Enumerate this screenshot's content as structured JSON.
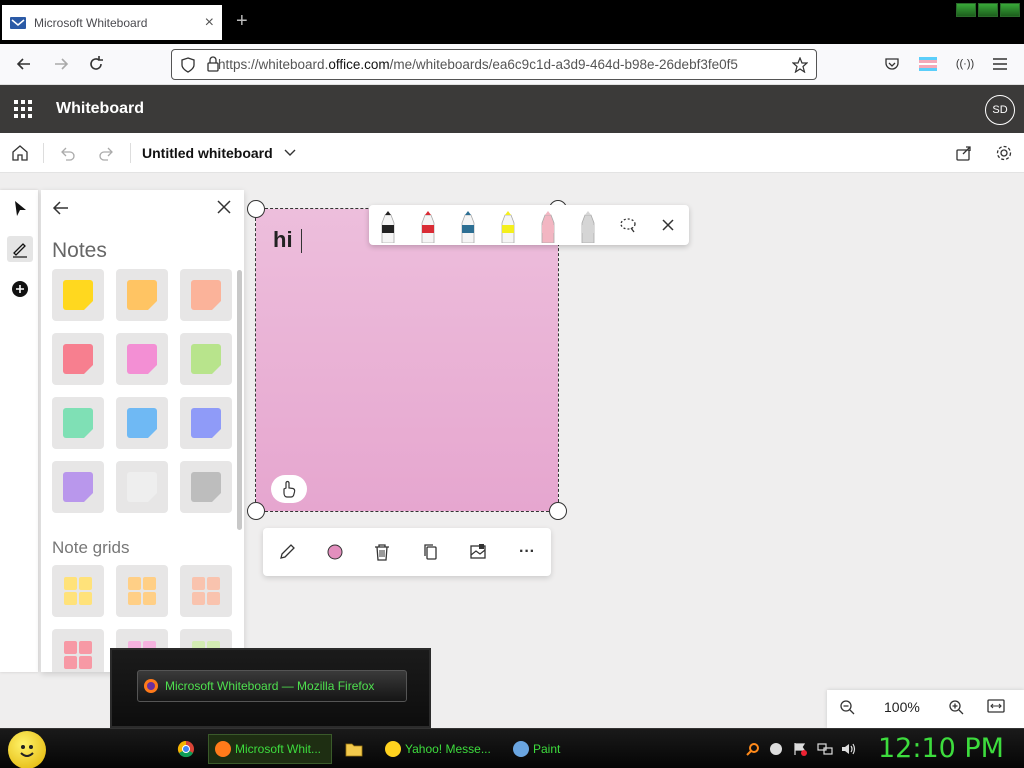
{
  "browser": {
    "tab_title": "Microsoft Whiteboard",
    "tab_close": "×",
    "new_tab": "+",
    "url_prefix": "https://whiteboard.",
    "url_domain": "office.com",
    "url_suffix": "/me/whiteboards/ea6c9c1d-a3d9-464d-b98e-26debf3fe0f5"
  },
  "app": {
    "title": "Whiteboard",
    "avatar_initials": "SD",
    "board_title": "Untitled whiteboard"
  },
  "panel": {
    "heading": "Notes",
    "grids_heading": "Note grids",
    "note_colors": [
      "#ffd81f",
      "#ffc463",
      "#fbb39a",
      "#f77f8f",
      "#f38fd4",
      "#b8e48c",
      "#7fe0b5",
      "#6fb9f4",
      "#8f9bf8",
      "#b997ec",
      "#eeeeee",
      "#bdbdbd"
    ],
    "grid_colors": [
      "#ffe27a",
      "#ffcf86",
      "#f9c3ae",
      "#f799a5",
      "#f5b3df",
      "#d3ecb3"
    ]
  },
  "note": {
    "text": "hi",
    "color": "#e9a9d2"
  },
  "pen_toolbar": {
    "pens": [
      {
        "name": "black-pen",
        "color": "#222222"
      },
      {
        "name": "red-pen",
        "color": "#d92c35"
      },
      {
        "name": "blue-pen",
        "color": "#2d6f93"
      },
      {
        "name": "yellow-highlighter",
        "color": "#f4ef1d"
      },
      {
        "name": "eraser",
        "color": "#f2b6c2"
      },
      {
        "name": "ruler",
        "color": "#d5d5d5"
      }
    ]
  },
  "note_toolbar": {
    "color_dot": "#e38fbe",
    "more": "···"
  },
  "zoom": {
    "level": "100%"
  },
  "popup": {
    "label": "Microsoft Whiteboard — Mozilla Firefox"
  },
  "taskbar": {
    "tasks": [
      {
        "label": "Microsoft Whit...",
        "color": "#ff7a1a"
      },
      {
        "label": "Yahoo! Messe...",
        "color": "#ffd21f"
      },
      {
        "label": "Paint",
        "color": "#6aa5e0"
      }
    ],
    "clock": "12:10 PM"
  }
}
